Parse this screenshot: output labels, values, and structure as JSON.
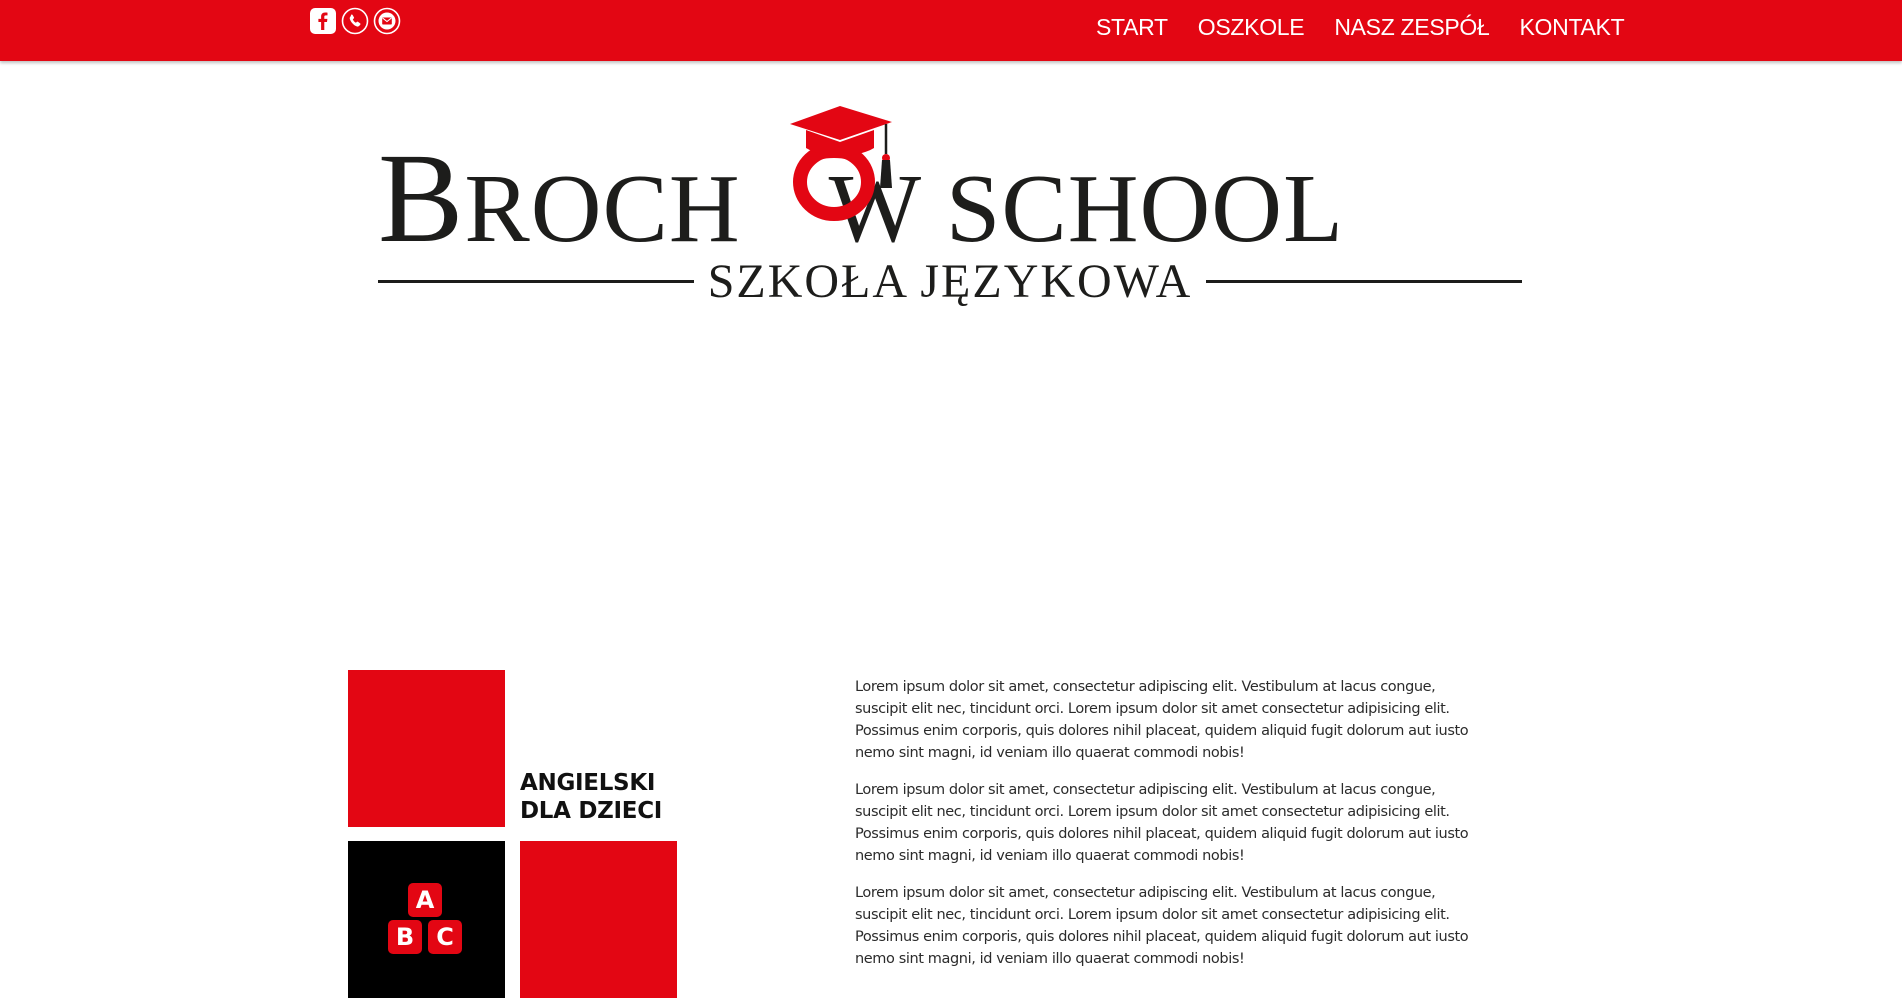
{
  "social": {
    "facebook_icon": "facebook-icon",
    "phone_icon": "phone-icon",
    "email_icon": "email-icon"
  },
  "nav": {
    "items": [
      {
        "label": "START"
      },
      {
        "label": "OSZKOLE"
      },
      {
        "label": "NASZ ZESPÓŁ"
      },
      {
        "label": "KONTAKT"
      }
    ]
  },
  "logo": {
    "brand_line_1": "B",
    "brand_line_2": "ROCH",
    "brand_line_3": "W S",
    "brand_line_4": "CHOOL",
    "subtitle": "SZKOŁA JĘZYKOWA"
  },
  "tiles": {
    "label_line_1": "ANGIELSKI",
    "label_line_2": "DLA DZIECI",
    "block_a": "A",
    "block_b": "B",
    "block_c": "C"
  },
  "content": {
    "paragraphs": [
      "Lorem ipsum dolor sit amet, consectetur adipiscing elit. Vestibulum at lacus congue, suscipit elit nec, tincidunt orci. Lorem ipsum dolor sit amet consectetur adipisicing elit. Possimus enim corporis, quis dolores nihil placeat, quidem aliquid fugit dolorum aut iusto nemo sint magni, id veniam illo quaerat commodi nobis!",
      "Lorem ipsum dolor sit amet, consectetur adipiscing elit. Vestibulum at lacus congue, suscipit elit nec, tincidunt orci. Lorem ipsum dolor sit amet consectetur adipisicing elit. Possimus enim corporis, quis dolores nihil placeat, quidem aliquid fugit dolorum aut iusto nemo sint magni, id veniam illo quaerat commodi nobis!",
      "Lorem ipsum dolor sit amet, consectetur adipiscing elit. Vestibulum at lacus congue, suscipit elit nec, tincidunt orci. Lorem ipsum dolor sit amet consectetur adipisicing elit. Possimus enim corporis, quis dolores nihil placeat, quidem aliquid fugit dolorum aut iusto nemo sint magni, id veniam illo quaerat commodi nobis!"
    ]
  },
  "colors": {
    "brand_red": "#e30613",
    "logo_dark": "#1d1d1b"
  }
}
